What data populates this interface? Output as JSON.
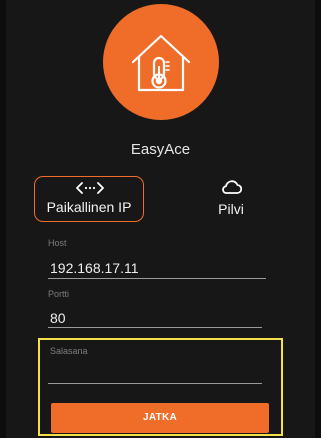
{
  "app": {
    "name": "EasyAce",
    "logo_icon": "house-thermometer-icon",
    "accent_color": "#ef6d29",
    "background_color": "#171717"
  },
  "connection_modes": {
    "selected": "local",
    "local": {
      "label": "Paikallinen IP",
      "icon": "code-brackets-icon"
    },
    "cloud": {
      "label": "Pilvi",
      "icon": "cloud-icon"
    }
  },
  "form": {
    "host": {
      "label": "Host",
      "value": "192.168.17.11"
    },
    "port": {
      "label": "Portti",
      "value": "80"
    },
    "password": {
      "label": "Salasana",
      "value": ""
    },
    "submit_label": "JATKA"
  },
  "highlight_color": "#f4e04a"
}
